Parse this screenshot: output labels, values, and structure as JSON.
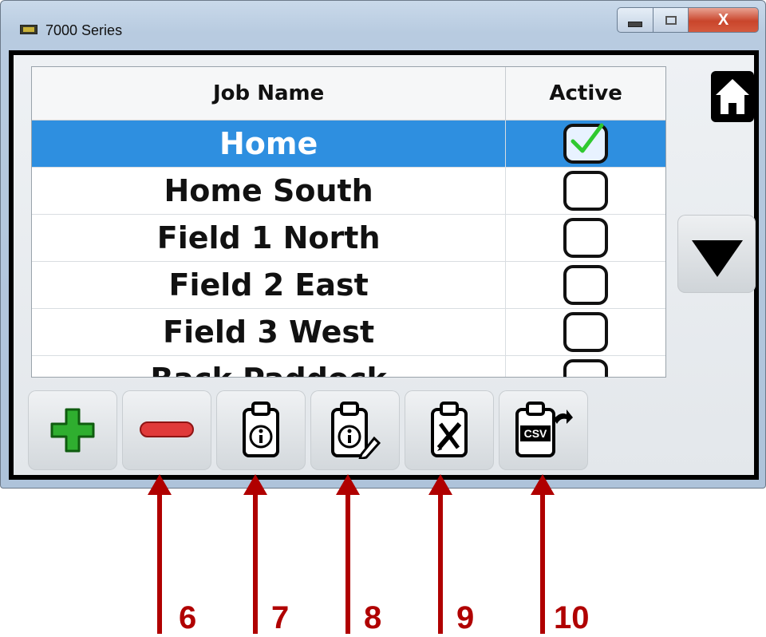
{
  "window": {
    "title": "7000 Series",
    "close_label": "X"
  },
  "table": {
    "headers": {
      "name": "Job Name",
      "active": "Active"
    },
    "rows": [
      {
        "name": "Home",
        "active": true,
        "selected": true
      },
      {
        "name": "Home South",
        "active": false,
        "selected": false
      },
      {
        "name": "Field 1 North",
        "active": false,
        "selected": false
      },
      {
        "name": "Field 2 East",
        "active": false,
        "selected": false
      },
      {
        "name": "Field 3 West",
        "active": false,
        "selected": false
      },
      {
        "name": "Back Paddock",
        "active": false,
        "selected": false
      }
    ]
  },
  "nav": {
    "home_icon": "home-icon",
    "scroll_down_icon": "triangle-down-icon"
  },
  "toolbar": {
    "buttons": [
      {
        "icon": "plus-icon",
        "color": "#2fae2f"
      },
      {
        "icon": "minus-icon",
        "color": "#d92c2c"
      },
      {
        "icon": "clipboard-info-icon"
      },
      {
        "icon": "clipboard-info-edit-icon"
      },
      {
        "icon": "clipboard-tools-icon"
      },
      {
        "icon": "clipboard-csv-export-icon",
        "badge": "CSV"
      }
    ]
  },
  "callouts": [
    "6",
    "7",
    "8",
    "9",
    "10"
  ],
  "colors": {
    "selection": "#2e8fe0",
    "callout": "#b00000",
    "check": "#2fc92f"
  }
}
